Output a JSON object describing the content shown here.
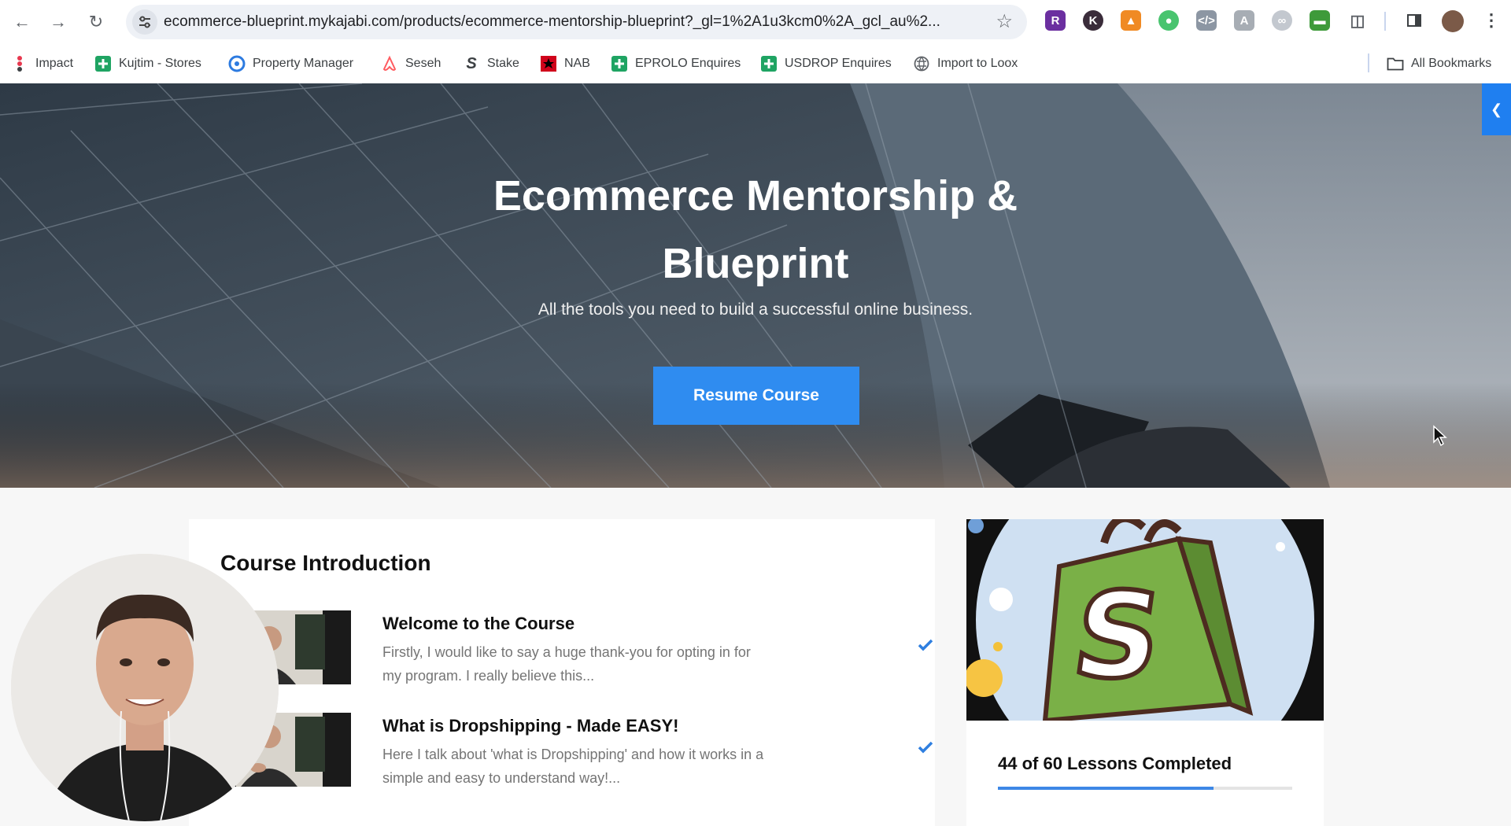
{
  "browser": {
    "url": "ecommerce-blueprint.mykajabi.com/products/ecommerce-mentorship-blueprint?_gl=1%2A1u3kcm0%2A_gcl_au%2...",
    "bookmarks": [
      {
        "label": "Impact"
      },
      {
        "label": "Kujtim - Stores"
      },
      {
        "label": "Property Manager"
      },
      {
        "label": "Seseh"
      },
      {
        "label": "Stake"
      },
      {
        "label": "NAB"
      },
      {
        "label": "EPROLO Enquires"
      },
      {
        "label": "USDROP Enquires"
      },
      {
        "label": "Import to Loox"
      }
    ],
    "all_bookmarks": "All Bookmarks"
  },
  "hero": {
    "title_line1": "Ecommerce Mentorship &",
    "title_line2": "Blueprint",
    "subtitle": "All the tools you need to build a successful online business.",
    "button": "Resume Course"
  },
  "course": {
    "section_title": "Course Introduction",
    "lessons": [
      {
        "title": "Welcome to the Course",
        "desc_line1": "Firstly, I would like to say a huge thank-you for opting in for",
        "desc_line2": "my program. I really believe this...",
        "completed": true
      },
      {
        "title": "What is Dropshipping - Made EASY!",
        "desc_line1": "Here I talk about 'what is Dropshipping' and how it works in a",
        "desc_line2": "simple and easy to understand way!...",
        "completed": true
      }
    ]
  },
  "progress": {
    "text": "44 of 60 Lessons Completed",
    "completed": 44,
    "total": 60
  },
  "colors": {
    "accent": "#2f8cf0",
    "check": "#2f7fe0",
    "shopify_green": "#7ab047"
  }
}
